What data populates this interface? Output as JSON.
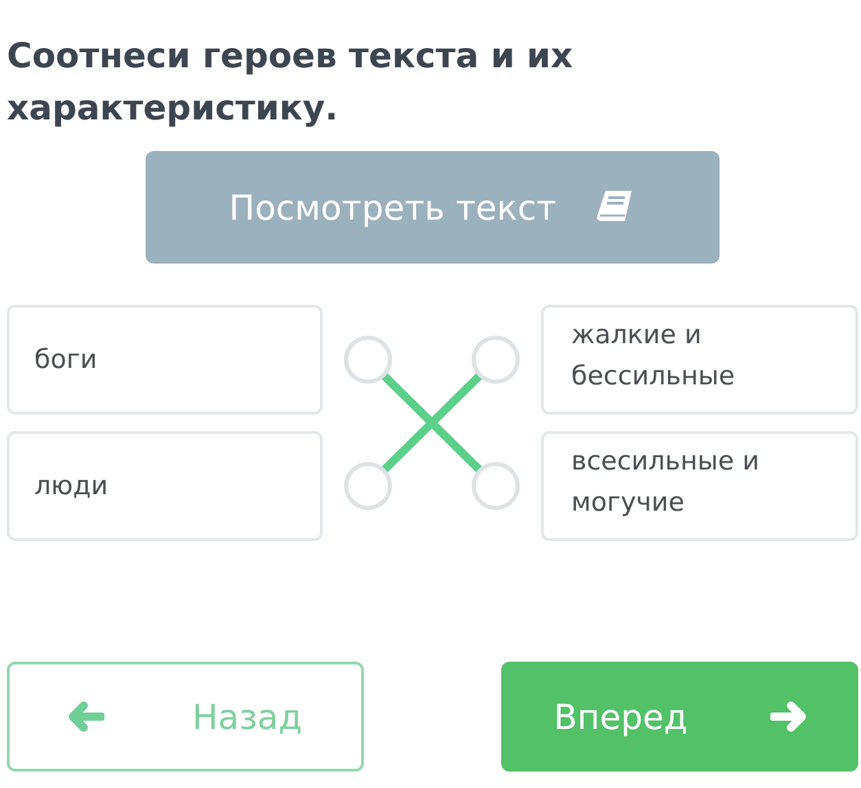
{
  "question": "Соотнеси героев текста и их характеристику.",
  "view_text_button": {
    "label": "Посмотреть текст"
  },
  "left_items": [
    "боги",
    "люди"
  ],
  "right_items": [
    "жалкие и бессильные",
    "всесильные и могучие"
  ],
  "connections": {
    "kind": "crossed"
  },
  "back_button": {
    "label": "Назад"
  },
  "next_button": {
    "label": "Вперед"
  }
}
